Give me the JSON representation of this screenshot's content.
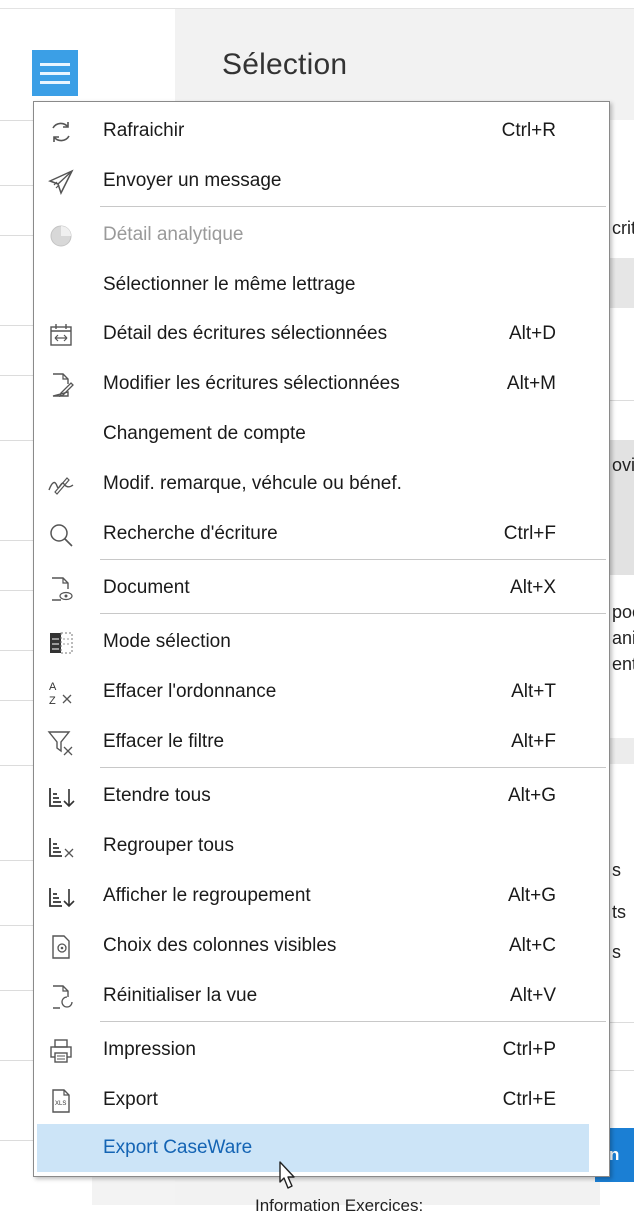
{
  "page": {
    "title": "Sélection"
  },
  "background_peek": [
    {
      "text": "crit"
    },
    {
      "text": "ovi."
    },
    {
      "text": "poc"
    },
    {
      "text": "ani"
    },
    {
      "text": "ent"
    },
    {
      "text": "s"
    },
    {
      "text": "ts"
    },
    {
      "text": "s"
    }
  ],
  "background_button": {
    "label": "n"
  },
  "background_bottom_text": "Information Exercices:",
  "menu": {
    "items": [
      {
        "label": "Rafraichir",
        "shortcut": "Ctrl+R",
        "icon": "refresh-icon",
        "disabled": false
      },
      {
        "label": "Envoyer un message",
        "shortcut": "",
        "icon": "send-icon",
        "disabled": false
      },
      {
        "label": "Détail analytique",
        "shortcut": "",
        "icon": "pie-chart-icon",
        "disabled": true
      },
      {
        "label": "Sélectionner le même lettrage",
        "shortcut": "",
        "icon": "",
        "disabled": false
      },
      {
        "label": "Détail des écritures sélectionnées",
        "shortcut": "Alt+D",
        "icon": "calendar-expand-icon",
        "disabled": false
      },
      {
        "label": "Modifier les écritures sélectionnées",
        "shortcut": "Alt+M",
        "icon": "edit-document-icon",
        "disabled": false
      },
      {
        "label": "Changement de compte",
        "shortcut": "",
        "icon": "",
        "disabled": false
      },
      {
        "label": "Modif. remarque, véhcule ou bénef.",
        "shortcut": "",
        "icon": "edit-signature-icon",
        "disabled": false
      },
      {
        "label": "Recherche d'écriture",
        "shortcut": "Ctrl+F",
        "icon": "search-icon",
        "disabled": false
      },
      {
        "label": "Document",
        "shortcut": "Alt+X",
        "icon": "document-view-icon",
        "disabled": false
      },
      {
        "label": "Mode sélection",
        "shortcut": "",
        "icon": "selection-mode-icon",
        "disabled": false
      },
      {
        "label": "Effacer l'ordonnance",
        "shortcut": "Alt+T",
        "icon": "clear-sort-icon",
        "disabled": false
      },
      {
        "label": "Effacer le filtre",
        "shortcut": "Alt+F",
        "icon": "clear-filter-icon",
        "disabled": false
      },
      {
        "label": "Etendre tous",
        "shortcut": "Alt+G",
        "icon": "expand-all-icon",
        "disabled": false
      },
      {
        "label": "Regrouper tous",
        "shortcut": "",
        "icon": "collapse-all-icon",
        "disabled": false
      },
      {
        "label": "Afficher le regroupement",
        "shortcut": "Alt+G",
        "icon": "show-grouping-icon",
        "disabled": false
      },
      {
        "label": "Choix des colonnes visibles",
        "shortcut": "Alt+C",
        "icon": "columns-settings-icon",
        "disabled": false
      },
      {
        "label": "Réinitialiser la vue",
        "shortcut": "Alt+V",
        "icon": "reset-view-icon",
        "disabled": false
      },
      {
        "label": "Impression",
        "shortcut": "Ctrl+P",
        "icon": "printer-icon",
        "disabled": false
      },
      {
        "label": "Export",
        "shortcut": "Ctrl+E",
        "icon": "export-xls-icon",
        "disabled": false
      },
      {
        "label": "Export CaseWare",
        "shortcut": "",
        "icon": "",
        "disabled": false,
        "highlighted": true
      }
    ]
  },
  "colors": {
    "hamburger": "#3b9fe6",
    "highlight": "#cce4f7",
    "highlight_text": "#1464b4",
    "accent_button": "#1b7fd4"
  }
}
